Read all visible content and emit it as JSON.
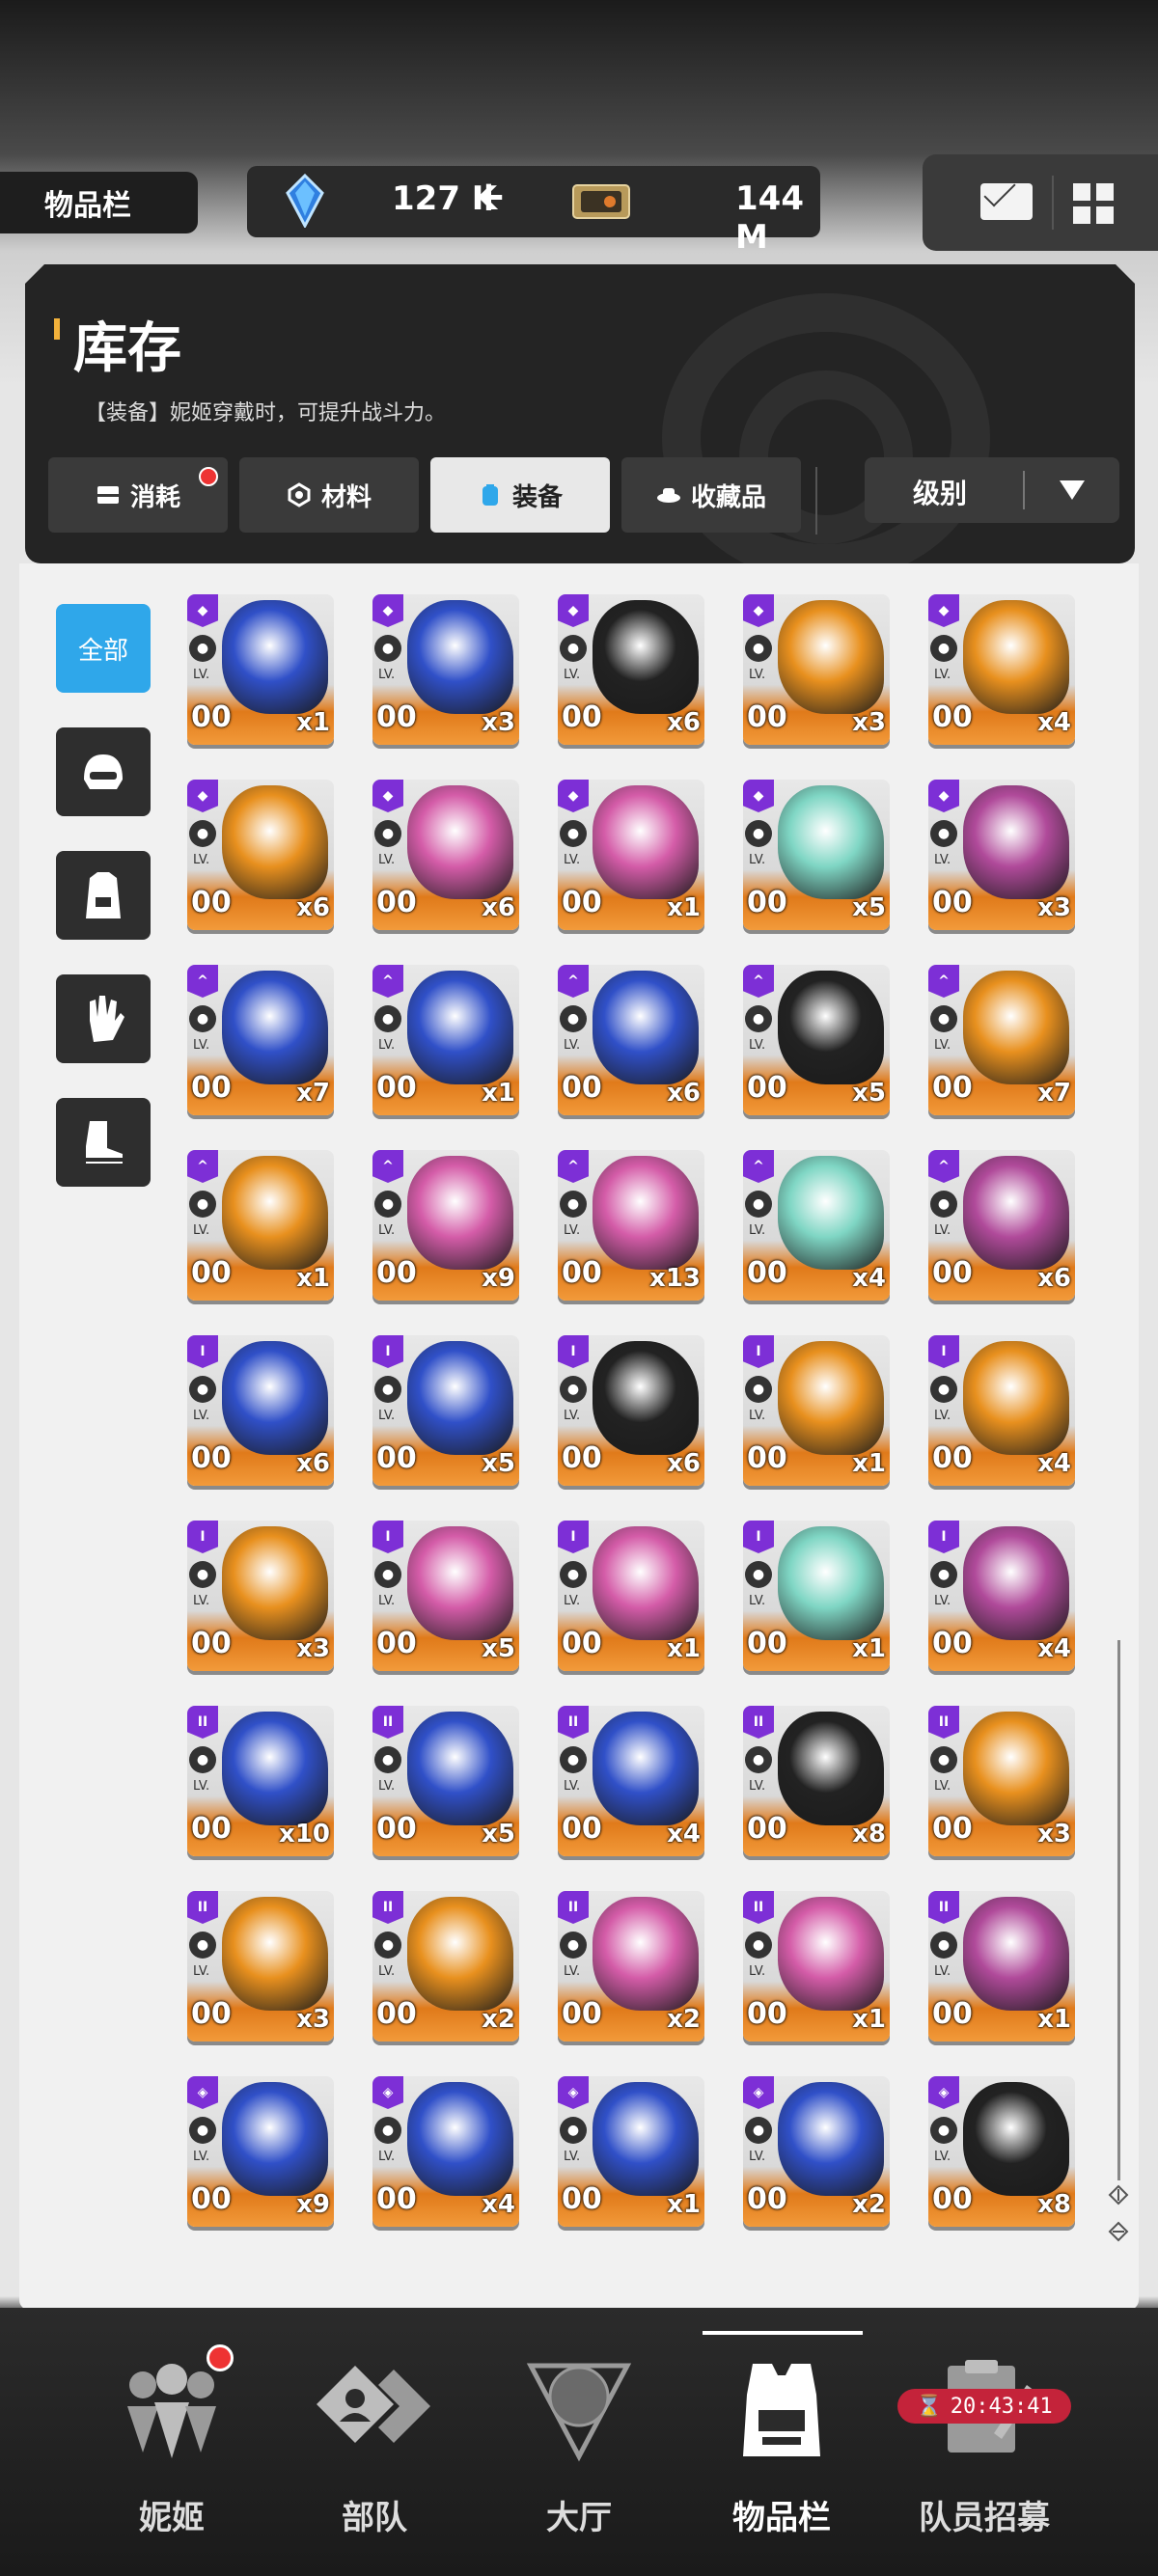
{
  "header": {
    "section_title": "物品栏",
    "gem_value": "127 K",
    "gem_plus": "+",
    "credit_value": "144 M",
    "icons": [
      "gem-icon",
      "plus-icon",
      "credit-ticket-icon",
      "mail-icon",
      "menu-grid-icon"
    ]
  },
  "panel": {
    "title": "库存",
    "description": "【装备】妮姬穿戴时，可提升战斗力。",
    "tabs": [
      {
        "label": "消耗",
        "icon": "consumable-icon",
        "notify": true
      },
      {
        "label": "材料",
        "icon": "material-icon",
        "notify": false
      },
      {
        "label": "装备",
        "icon": "equipment-icon",
        "notify": false,
        "active": true
      },
      {
        "label": "收藏品",
        "icon": "collection-icon",
        "notify": false
      }
    ],
    "sort_label": "级别"
  },
  "side_filters": [
    {
      "label": "全部",
      "icon": "",
      "active": true
    },
    {
      "label": "",
      "icon": "helmet-icon"
    },
    {
      "label": "",
      "icon": "armor-icon"
    },
    {
      "label": "",
      "icon": "gloves-icon"
    },
    {
      "label": "",
      "icon": "boots-icon"
    }
  ],
  "item_level_label": "LV.",
  "item_level_value": "00",
  "items": [
    {
      "rank": "◆",
      "qty": "x1",
      "color": "#3050c8"
    },
    {
      "rank": "◆",
      "qty": "x3",
      "color": "#3050c8"
    },
    {
      "rank": "◆",
      "qty": "x6",
      "color": "#222222"
    },
    {
      "rank": "◆",
      "qty": "x3",
      "color": "#e8901e"
    },
    {
      "rank": "◆",
      "qty": "x4",
      "color": "#e8901e"
    },
    {
      "rank": "◆",
      "qty": "x6",
      "color": "#e8901e"
    },
    {
      "rank": "◆",
      "qty": "x6",
      "color": "#d45ca8"
    },
    {
      "rank": "◆",
      "qty": "x1",
      "color": "#d45ca8"
    },
    {
      "rank": "◆",
      "qty": "x5",
      "color": "#7fd6c4"
    },
    {
      "rank": "◆",
      "qty": "x3",
      "color": "#b04a9a"
    },
    {
      "rank": "^",
      "qty": "x7",
      "color": "#3050c8"
    },
    {
      "rank": "^",
      "qty": "x1",
      "color": "#3050c8"
    },
    {
      "rank": "^",
      "qty": "x6",
      "color": "#3050c8"
    },
    {
      "rank": "^",
      "qty": "x5",
      "color": "#222222"
    },
    {
      "rank": "^",
      "qty": "x7",
      "color": "#e8901e"
    },
    {
      "rank": "^",
      "qty": "x1",
      "color": "#e8901e"
    },
    {
      "rank": "^",
      "qty": "x9",
      "color": "#d45ca8"
    },
    {
      "rank": "^",
      "qty": "x13",
      "color": "#d45ca8"
    },
    {
      "rank": "^",
      "qty": "x4",
      "color": "#7fd6c4"
    },
    {
      "rank": "^",
      "qty": "x6",
      "color": "#b04a9a"
    },
    {
      "rank": "I",
      "qty": "x6",
      "color": "#3050c8"
    },
    {
      "rank": "I",
      "qty": "x5",
      "color": "#3050c8"
    },
    {
      "rank": "I",
      "qty": "x6",
      "color": "#222222"
    },
    {
      "rank": "I",
      "qty": "x1",
      "color": "#e8901e"
    },
    {
      "rank": "I",
      "qty": "x4",
      "color": "#e8901e"
    },
    {
      "rank": "I",
      "qty": "x3",
      "color": "#e8901e"
    },
    {
      "rank": "I",
      "qty": "x5",
      "color": "#d45ca8"
    },
    {
      "rank": "I",
      "qty": "x1",
      "color": "#d45ca8"
    },
    {
      "rank": "I",
      "qty": "x1",
      "color": "#7fd6c4"
    },
    {
      "rank": "I",
      "qty": "x4",
      "color": "#b04a9a"
    },
    {
      "rank": "II",
      "qty": "x10",
      "color": "#3050c8"
    },
    {
      "rank": "II",
      "qty": "x5",
      "color": "#3050c8"
    },
    {
      "rank": "II",
      "qty": "x4",
      "color": "#3050c8"
    },
    {
      "rank": "II",
      "qty": "x8",
      "color": "#222222"
    },
    {
      "rank": "II",
      "qty": "x3",
      "color": "#e8901e"
    },
    {
      "rank": "II",
      "qty": "x3",
      "color": "#e8901e"
    },
    {
      "rank": "II",
      "qty": "x2",
      "color": "#e8901e"
    },
    {
      "rank": "II",
      "qty": "x2",
      "color": "#d45ca8"
    },
    {
      "rank": "II",
      "qty": "x1",
      "color": "#d45ca8"
    },
    {
      "rank": "II",
      "qty": "x1",
      "color": "#b04a9a"
    },
    {
      "rank": "◈",
      "qty": "x9",
      "color": "#3050c8"
    },
    {
      "rank": "◈",
      "qty": "x4",
      "color": "#3050c8"
    },
    {
      "rank": "◈",
      "qty": "x1",
      "color": "#3050c8"
    },
    {
      "rank": "◈",
      "qty": "x2",
      "color": "#3050c8"
    },
    {
      "rank": "◈",
      "qty": "x8",
      "color": "#222222"
    }
  ],
  "bottom_nav": [
    {
      "label": "妮姬",
      "icon": "nikke-icon",
      "notify": true
    },
    {
      "label": "部队",
      "icon": "squad-icon"
    },
    {
      "label": "大厅",
      "icon": "lobby-icon"
    },
    {
      "label": "物品栏",
      "icon": "inventory-icon",
      "active": true
    },
    {
      "label": "队员招募",
      "icon": "recruit-icon"
    }
  ],
  "recruit_timer": "20:43:41"
}
